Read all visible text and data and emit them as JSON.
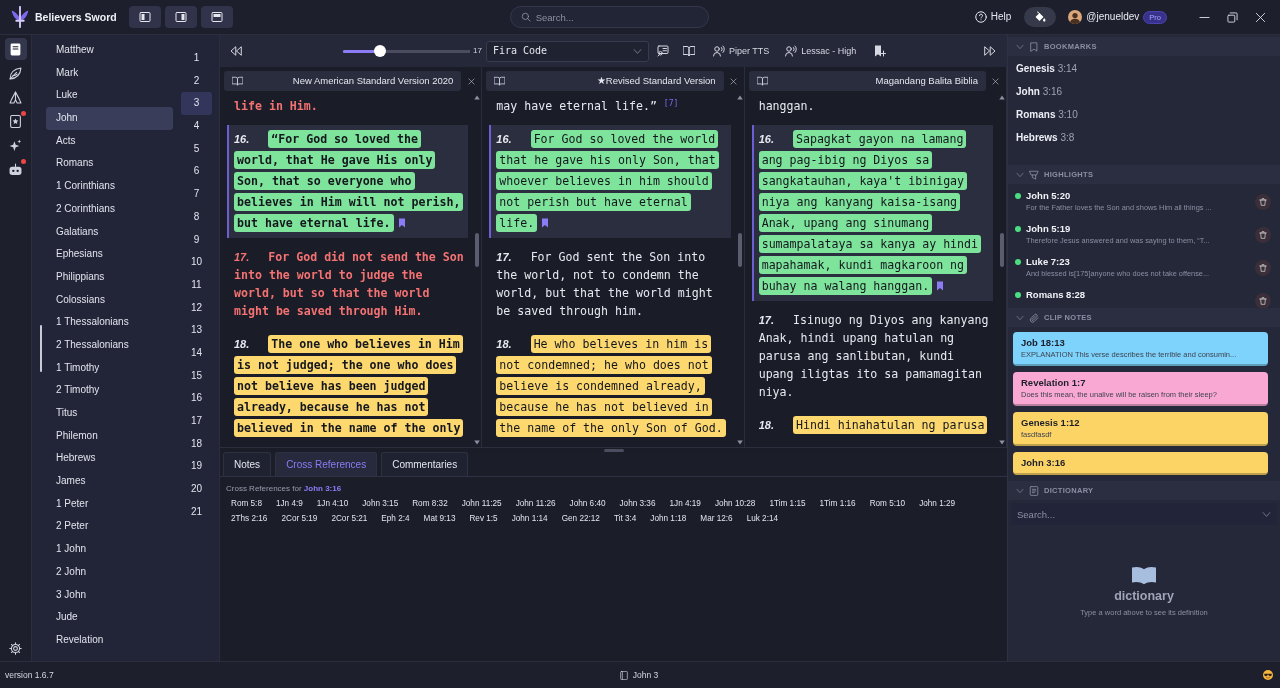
{
  "app": {
    "title": "Believers Sword"
  },
  "search": {
    "placeholder": "Search..."
  },
  "account": {
    "help": "Help",
    "username": "@jenueldev",
    "plan": "Pro"
  },
  "sidebar_tabs": [
    {
      "kind": "bible",
      "selected": true,
      "notification": false
    },
    {
      "kind": "leaves",
      "selected": false,
      "notification": false
    },
    {
      "kind": "prayer",
      "selected": false,
      "notification": false
    },
    {
      "kind": "notes",
      "selected": false,
      "notification": true
    },
    {
      "kind": "sparkles",
      "selected": false,
      "notification": false
    },
    {
      "kind": "robot",
      "selected": false,
      "notification": true
    }
  ],
  "books": [
    {
      "name": "Matthew",
      "selected": false
    },
    {
      "name": "Mark",
      "selected": false
    },
    {
      "name": "Luke",
      "selected": false
    },
    {
      "name": "John",
      "selected": true
    },
    {
      "name": "Acts",
      "selected": false
    },
    {
      "name": "Romans",
      "selected": false
    },
    {
      "name": "1 Corinthians",
      "selected": false
    },
    {
      "name": "2 Corinthians",
      "selected": false
    },
    {
      "name": "Galatians",
      "selected": false
    },
    {
      "name": "Ephesians",
      "selected": false
    },
    {
      "name": "Philippians",
      "selected": false
    },
    {
      "name": "Colossians",
      "selected": false
    },
    {
      "name": "1 Thessalonians",
      "selected": false
    },
    {
      "name": "2 Thessalonians",
      "selected": false
    },
    {
      "name": "1 Timothy",
      "selected": false
    },
    {
      "name": "2 Timothy",
      "selected": false
    },
    {
      "name": "Titus",
      "selected": false
    },
    {
      "name": "Philemon",
      "selected": false
    },
    {
      "name": "Hebrews",
      "selected": false
    },
    {
      "name": "James",
      "selected": false
    },
    {
      "name": "1 Peter",
      "selected": false
    },
    {
      "name": "2 Peter",
      "selected": false
    },
    {
      "name": "1 John",
      "selected": false
    },
    {
      "name": "2 John",
      "selected": false
    },
    {
      "name": "3 John",
      "selected": false
    },
    {
      "name": "Jude",
      "selected": false
    },
    {
      "name": "Revelation",
      "selected": false
    }
  ],
  "chapters": [
    {
      "number": "1",
      "selected": false
    },
    {
      "number": "2",
      "selected": false
    },
    {
      "number": "3",
      "selected": true
    },
    {
      "number": "4",
      "selected": false
    },
    {
      "number": "5",
      "selected": false
    },
    {
      "number": "6",
      "selected": false
    },
    {
      "number": "7",
      "selected": false
    },
    {
      "number": "8",
      "selected": false
    },
    {
      "number": "9",
      "selected": false
    },
    {
      "number": "10",
      "selected": false
    },
    {
      "number": "11",
      "selected": false
    },
    {
      "number": "12",
      "selected": false
    },
    {
      "number": "13",
      "selected": false
    },
    {
      "number": "14",
      "selected": false
    },
    {
      "number": "15",
      "selected": false
    },
    {
      "number": "16",
      "selected": false
    },
    {
      "number": "17",
      "selected": false
    },
    {
      "number": "18",
      "selected": false
    },
    {
      "number": "19",
      "selected": false
    },
    {
      "number": "20",
      "selected": false
    },
    {
      "number": "21",
      "selected": false
    }
  ],
  "toolbar": {
    "font_size": {
      "level": 0.29,
      "reading": "17"
    },
    "font": "Fira Code",
    "voice_engine": "Piper TTS",
    "voice": "Lessac - High"
  },
  "panels": [
    {
      "title": "New American Standard Version 2020",
      "bold_text": true,
      "verses": [
        {
          "text": "life in Him.",
          "red_letter": true,
          "selected": false,
          "bookmarked": false
        },
        {
          "number": "16.",
          "text": "“For God so loved the world, that He gave His only Son, that so everyone who believes in Him will not perish, but have eternal life.",
          "red_letter": false,
          "selected": true,
          "bookmarked": true,
          "color": "#7ee49c"
        },
        {
          "number": "17.",
          "text": "For God did not send the Son into the world to judge the world, but so that the world might be saved through Him.",
          "red_letter": true,
          "selected": false,
          "bookmarked": false
        },
        {
          "number": "18.",
          "text": "The one who believes in Him is not judged; the one who does not believe has been judged already, because he has not believed in the name of the only",
          "red_letter": false,
          "selected": false,
          "bookmarked": false,
          "color": "#fcd86f"
        }
      ]
    },
    {
      "title": "★Revised Standard Version",
      "bold_text": false,
      "verses": [
        {
          "text": "may have eternal life.” $^{[7]}$",
          "red_letter": false,
          "selected": false,
          "bookmarked": false
        },
        {
          "number": "16.",
          "text": "For God so loved the world that he gave his only Son, that whoever believes in him should not perish but have eternal life.",
          "red_letter": false,
          "selected": true,
          "bookmarked": true,
          "color": "#7ee49c"
        },
        {
          "number": "17.",
          "text": "For God sent the Son into the world, not to condemn the world, but that the world might be saved through him.",
          "red_letter": false,
          "selected": false,
          "bookmarked": false
        },
        {
          "number": "18.",
          "text": "He who believes in him is not condemned; he who does not believe is condemned already, because he has not believed in the name of the only Son of God.",
          "red_letter": false,
          "selected": false,
          "bookmarked": false,
          "color": "#fcd86f"
        }
      ]
    },
    {
      "title": "Magandang Balita Biblia",
      "bold_text": false,
      "verses": [
        {
          "text": "hanggan.",
          "red_letter": false,
          "selected": false,
          "bookmarked": false
        },
        {
          "number": "16.",
          "text": "Sapagkat gayon na lamang ang pag-ibig ng Diyos sa sangkatauhan, kaya't ibinigay niya ang kanyang kaisa-isang Anak, upang ang sinumang sumampalataya sa kanya ay hindi mapahamak, kundi magkaroon ng buhay na walang hanggan.",
          "red_letter": false,
          "selected": true,
          "bookmarked": true,
          "color": "#7ee49c"
        },
        {
          "number": "17.",
          "text": "Isinugo ng Diyos ang kanyang Anak, hindi upang hatulan ng parusa ang sanlibutan, kundi upang iligtas ito sa pamamagitan niya.",
          "red_letter": false,
          "selected": false,
          "bookmarked": false
        },
        {
          "number": "18.",
          "text": "Hindi hinahatulan ng parusa",
          "red_letter": false,
          "selected": false,
          "bookmarked": false,
          "color": "#fcd86f"
        }
      ]
    }
  ],
  "bottom_panel": {
    "tabs": [
      {
        "label": "Notes",
        "selected": false
      },
      {
        "label": "Cross References",
        "selected": true
      },
      {
        "label": "Commentaries",
        "selected": false
      }
    ],
    "heading": "Cross References for **John 3:16**",
    "references": [
      "Rom 5:8",
      "1Jn 4:9",
      "1Jn 4:10",
      "John 3:15",
      "Rom 8:32",
      "John 11:25",
      "John 11:26",
      "John 6:40",
      "John 3:36",
      "1Jn 4:19",
      "John 10:28",
      "1Tim 1:15",
      "1Tim 1:16",
      "Rom 5:10",
      "John 1:29",
      "2Ths 2:16",
      "2Cor 5:19",
      "2Cor 5:21",
      "Eph 2:4",
      "Mat 9:13",
      "Rev 1:5",
      "John 1:14",
      "Gen 22:12",
      "Tit 3:4",
      "John 1:18",
      "Mar 12:6",
      "Luk 2:14"
    ]
  },
  "right_panel": {
    "bookmarks": {
      "title": "BOOKMARKS",
      "expanded": true,
      "items": [
        {
          "book": "Genesis",
          "verse": "3:14"
        },
        {
          "book": "John",
          "verse": "3:16"
        },
        {
          "book": "Romans",
          "verse": "3:10"
        },
        {
          "book": "Hebrews",
          "verse": "3:8"
        }
      ]
    },
    "highlights": {
      "title": "HIGHLIGHTS",
      "expanded": true,
      "items": [
        {
          "reference": "John 5:20",
          "snippet": "For the Father loves the Son and shows Him all things ...",
          "color": "#4ade80"
        },
        {
          "reference": "John 5:19",
          "snippet": "Therefore Jesus answered and was saying to them, “T...",
          "color": "#4ade80"
        },
        {
          "reference": "Luke 7:23",
          "snippet": "And blessed is[175]anyone who does not take offense...",
          "color": "#4ade80"
        },
        {
          "reference": "Romans 8:28",
          "color": "#4ade80"
        }
      ]
    },
    "clip_notes": {
      "title": "CLIP NOTES",
      "expanded": true,
      "items": [
        {
          "reference": "Job 18:13",
          "note": "EXPLANATION This verse describes the terrible and consumin...",
          "color": "#7dd3fc"
        },
        {
          "reference": "Revelation 1:7",
          "note": "Does this mean, the unalive will be raisen from their sleep?",
          "color": "#f9a8d4"
        },
        {
          "reference": "Genesis 1:12",
          "note": "fasdfasdf",
          "color": "#fcd466"
        },
        {
          "reference": "John 3:16",
          "color": "#fcd466"
        }
      ]
    },
    "dictionary": {
      "title": "DICTIONARY",
      "expanded": true,
      "placeholder": "Search...",
      "empty_title": "dictionary",
      "empty_hint": "Type a word above to see its definition"
    }
  },
  "status_bar": {
    "version": "version 1.6.7",
    "location": "John 3"
  }
}
